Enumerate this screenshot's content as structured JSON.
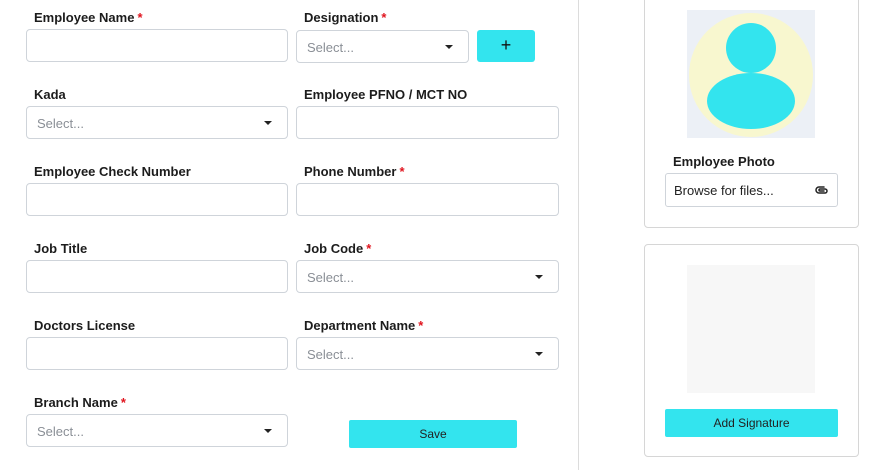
{
  "form": {
    "employee_name": {
      "label": "Employee Name",
      "required": "*",
      "value": ""
    },
    "designation": {
      "label": "Designation",
      "required": "*",
      "placeholder": "Select..."
    },
    "add_designation_label": "+",
    "kada": {
      "label": "Kada",
      "placeholder": "Select..."
    },
    "pfno": {
      "label": "Employee PFNO / MCT NO",
      "value": ""
    },
    "check_number": {
      "label": "Employee Check Number",
      "value": ""
    },
    "phone": {
      "label": "Phone Number",
      "required": "*",
      "value": ""
    },
    "job_title": {
      "label": "Job Title",
      "value": ""
    },
    "job_code": {
      "label": "Job Code",
      "required": "*",
      "placeholder": "Select..."
    },
    "doctors_license": {
      "label": "Doctors License",
      "value": ""
    },
    "department": {
      "label": "Department Name",
      "required": "*",
      "placeholder": "Select..."
    },
    "branch": {
      "label": "Branch Name",
      "required": "*",
      "placeholder": "Select..."
    },
    "save_label": "Save"
  },
  "photo": {
    "label": "Employee Photo",
    "browse_text": "Browse for files...",
    "avatar_icon": "user-avatar-icon",
    "attach_icon": "paperclip-icon"
  },
  "signature": {
    "button_label": "Add Signature"
  },
  "colors": {
    "accent": "#33e4ee",
    "required": "#e0141e",
    "avatar_bg": "#f8f7cf"
  }
}
